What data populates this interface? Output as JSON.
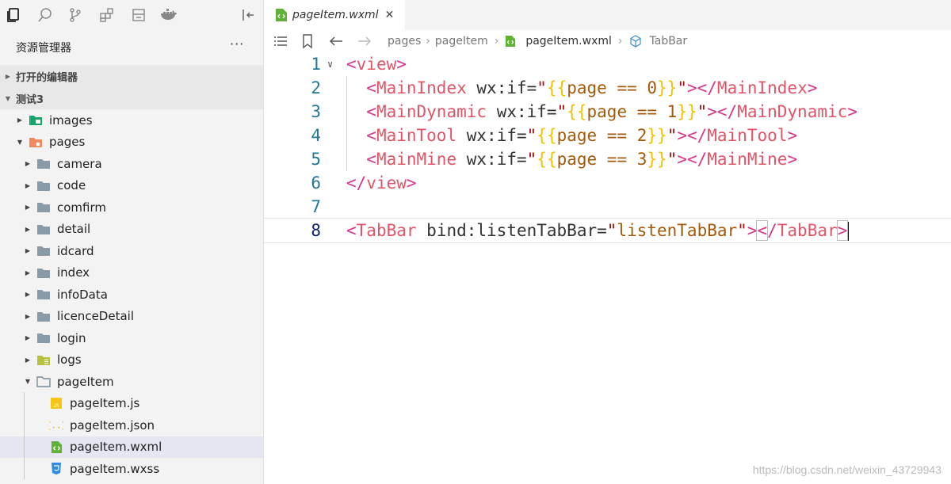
{
  "sidebar": {
    "explorer_title": "资源管理器",
    "more": "···",
    "open_editors": "打开的编辑器",
    "project": "测试3",
    "items": [
      {
        "label": "images",
        "icon": "folder-images-icon",
        "level": 1,
        "expanded": false
      },
      {
        "label": "pages",
        "icon": "folder-pages-icon",
        "level": 1,
        "expanded": true
      },
      {
        "label": "camera",
        "icon": "folder-icon",
        "level": 2,
        "expanded": false
      },
      {
        "label": "code",
        "icon": "folder-icon",
        "level": 2,
        "expanded": false
      },
      {
        "label": "comfirm",
        "icon": "folder-icon",
        "level": 2,
        "expanded": false
      },
      {
        "label": "detail",
        "icon": "folder-icon",
        "level": 2,
        "expanded": false
      },
      {
        "label": "idcard",
        "icon": "folder-icon",
        "level": 2,
        "expanded": false
      },
      {
        "label": "index",
        "icon": "folder-icon",
        "level": 2,
        "expanded": false
      },
      {
        "label": "infoData",
        "icon": "folder-icon",
        "level": 2,
        "expanded": false
      },
      {
        "label": "licenceDetail",
        "icon": "folder-icon",
        "level": 2,
        "expanded": false
      },
      {
        "label": "login",
        "icon": "folder-icon",
        "level": 2,
        "expanded": false
      },
      {
        "label": "logs",
        "icon": "folder-logs-icon",
        "level": 2,
        "expanded": false
      },
      {
        "label": "pageItem",
        "icon": "folder-open-icon",
        "level": 2,
        "expanded": true
      },
      {
        "label": "pageItem.js",
        "icon": "js-file-icon",
        "level": 3
      },
      {
        "label": "pageItem.json",
        "icon": "json-file-icon",
        "level": 3
      },
      {
        "label": "pageItem.wxml",
        "icon": "wxml-file-icon",
        "level": 3,
        "selected": true
      },
      {
        "label": "pageItem.wxss",
        "icon": "wxss-file-icon",
        "level": 3
      }
    ]
  },
  "tab": {
    "label": "pageItem.wxml",
    "close": "✕"
  },
  "breadcrumb": {
    "seg1": "pages",
    "seg2": "pageItem",
    "seg3": "pageItem.wxml",
    "seg4": "TabBar"
  },
  "code": {
    "line_numbers": [
      "1",
      "2",
      "3",
      "4",
      "5",
      "6",
      "7",
      "8"
    ],
    "l1": {
      "open": "<",
      "tag": "view",
      "close": ">"
    },
    "l2": {
      "tag": "MainIndex",
      "attr": "wx:if",
      "expr": "page == 0",
      "endtag": "MainIndex"
    },
    "l3": {
      "tag": "MainDynamic",
      "attr": "wx:if",
      "expr": "page == 1",
      "endtag": "MainDynamic"
    },
    "l4": {
      "tag": "MainTool",
      "attr": "wx:if",
      "expr": "page == 2",
      "endtag": "MainTool"
    },
    "l5": {
      "tag": "MainMine",
      "attr": "wx:if",
      "expr": "page == 3",
      "endtag": "MainMine"
    },
    "l6": {
      "endtag": "view"
    },
    "l8": {
      "tag": "TabBar",
      "attr": "bind:listenTabBar",
      "value": "listenTabBar",
      "endtag": "TabBar"
    }
  },
  "watermark": "https://blog.csdn.net/weixin_43729943",
  "colors": {
    "accent": "#0b216f",
    "selected_row": "#e4e6f1",
    "wxml_icon": "#5fb236"
  }
}
